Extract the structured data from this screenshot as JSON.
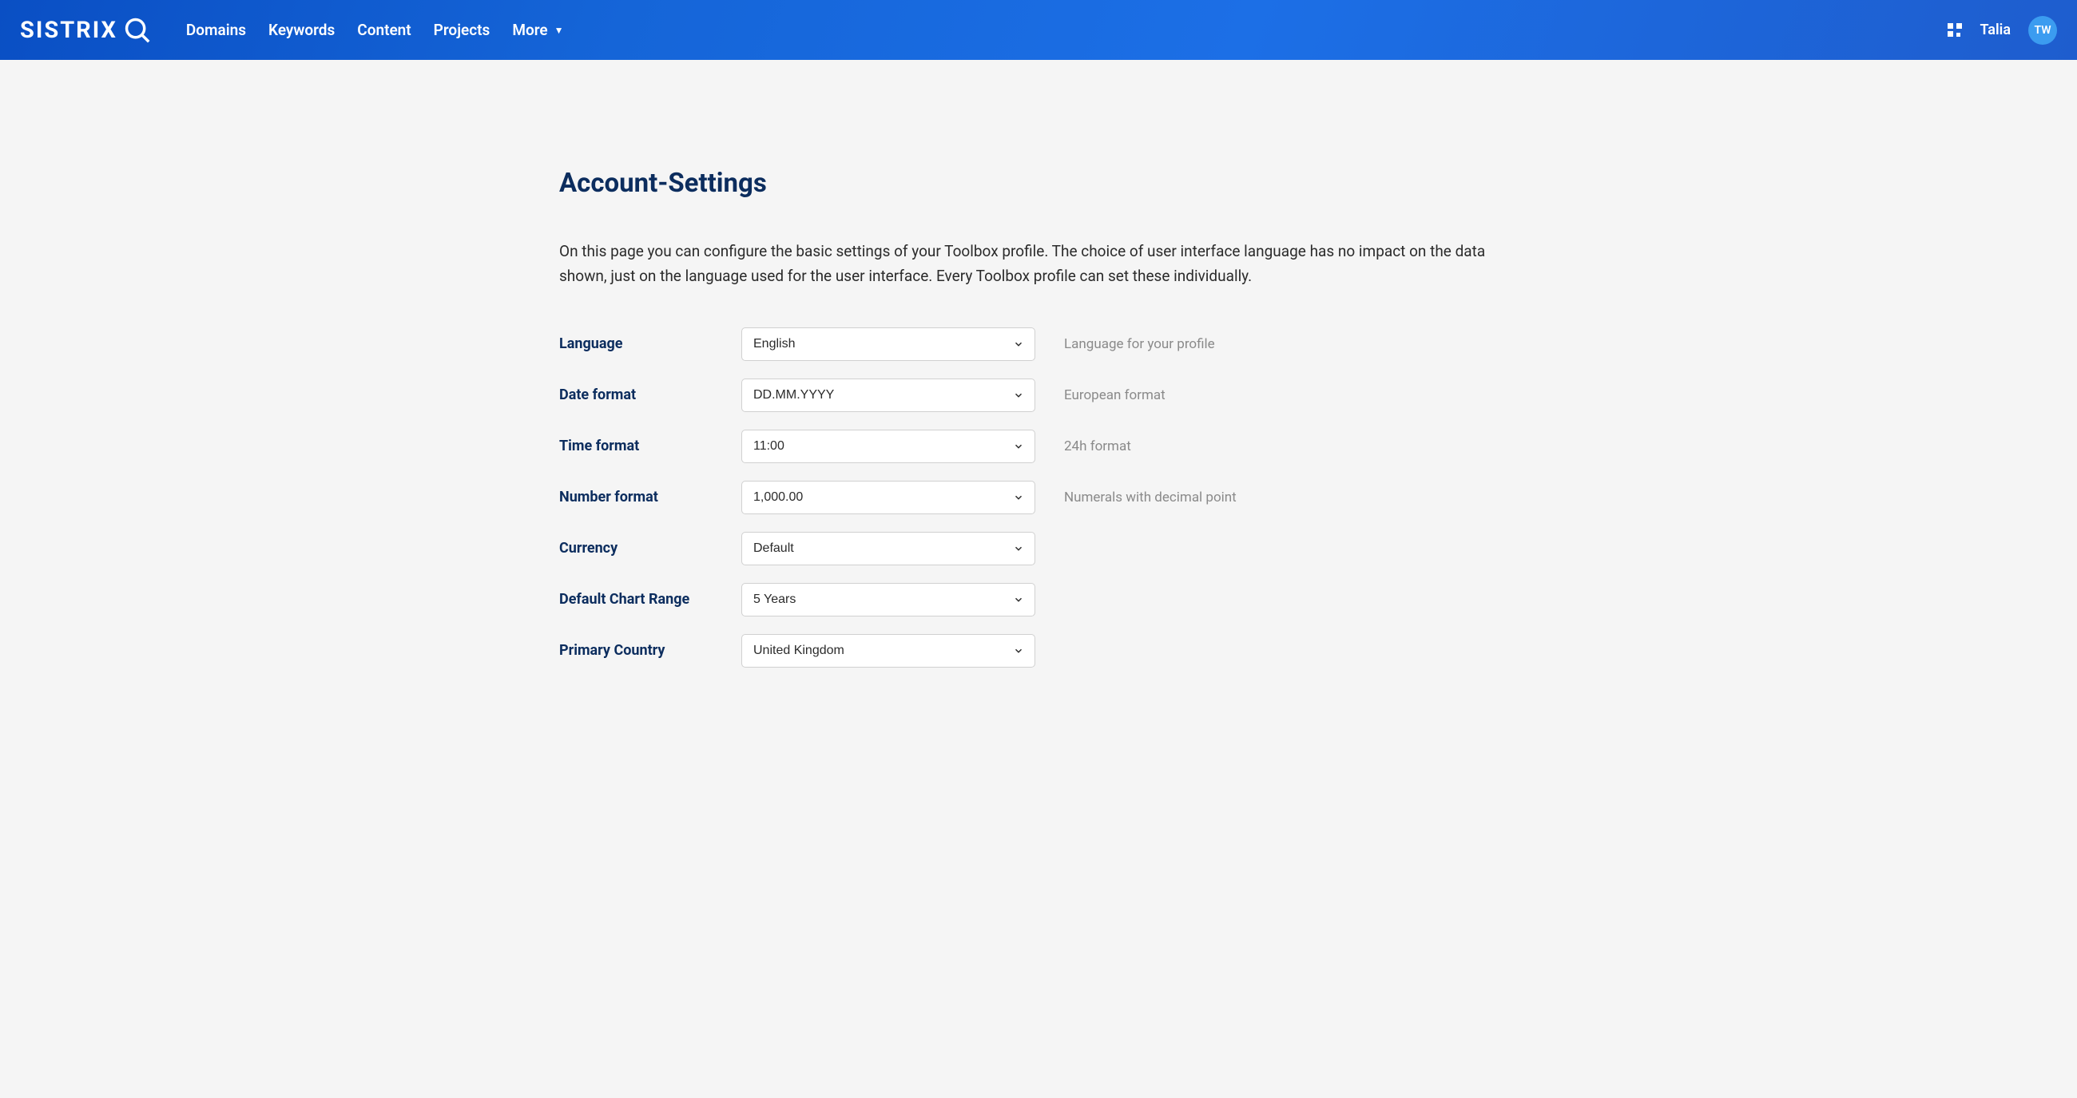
{
  "header": {
    "logo_text": "SISTRIX",
    "nav": {
      "domains": "Domains",
      "keywords": "Keywords",
      "content": "Content",
      "projects": "Projects",
      "more": "More"
    },
    "username": "Talia",
    "avatar_initials": "TW"
  },
  "page": {
    "title": "Account-Settings",
    "description": "On this page you can configure the basic settings of your Toolbox profile. The choice of user interface language has no impact on the data shown, just on the language used for the user interface. Every Toolbox profile can set these individually."
  },
  "settings": {
    "language": {
      "label": "Language",
      "value": "English",
      "hint": "Language for your profile"
    },
    "date_format": {
      "label": "Date format",
      "value": "DD.MM.YYYY",
      "hint": "European format"
    },
    "time_format": {
      "label": "Time format",
      "value": "11:00",
      "hint": "24h format"
    },
    "number_format": {
      "label": "Number format",
      "value": "1,000.00",
      "hint": "Numerals with decimal point"
    },
    "currency": {
      "label": "Currency",
      "value": "Default",
      "hint": ""
    },
    "default_chart_range": {
      "label": "Default Chart Range",
      "value": "5 Years",
      "hint": ""
    },
    "primary_country": {
      "label": "Primary Country",
      "value": "United Kingdom",
      "hint": ""
    }
  }
}
